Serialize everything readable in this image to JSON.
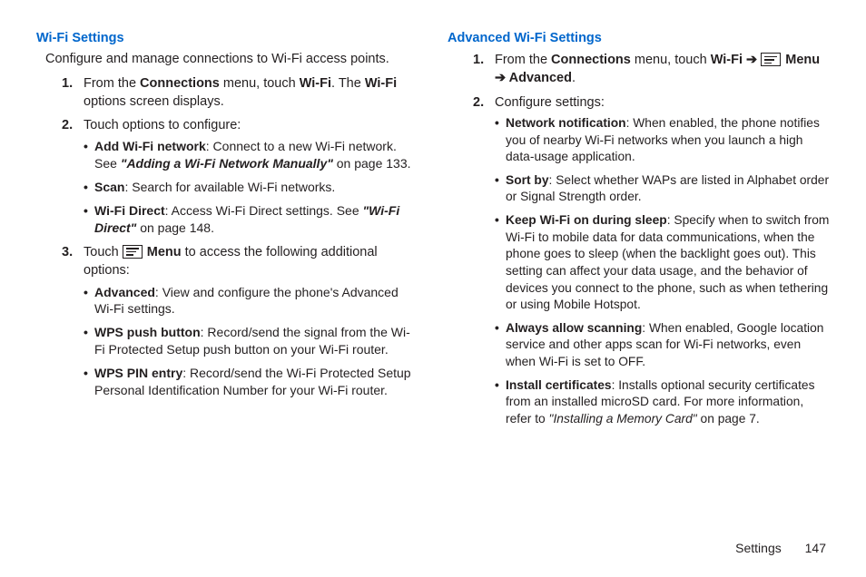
{
  "left": {
    "title": "Wi-Fi Settings",
    "intro": "Configure and manage connections to Wi-Fi access points.",
    "s1_num": "1.",
    "s1_a": "From the ",
    "s1_b": "Connections",
    "s1_c": " menu, touch ",
    "s1_d": "Wi-Fi",
    "s1_e": ". The ",
    "s1_f": "Wi-Fi",
    "s1_g": " options screen displays.",
    "s2_num": "2.",
    "s2_text": "Touch options to configure:",
    "s2_b1_a": "Add Wi-Fi network",
    "s2_b1_b": ": Connect to a new Wi-Fi network. See ",
    "s2_b1_c": "\"Adding a Wi-Fi Network Manually\"",
    "s2_b1_d": " on page 133.",
    "s2_b2_a": "Scan",
    "s2_b2_b": ": Search for available Wi-Fi networks.",
    "s2_b3_a": "Wi-Fi Direct",
    "s2_b3_b": ": Access Wi-Fi Direct settings. See ",
    "s2_b3_c": "\"Wi-Fi Direct\"",
    "s2_b3_d": " on page 148.",
    "s3_num": "3.",
    "s3_a": "Touch ",
    "s3_b": "Menu",
    "s3_c": " to access the following additional options:",
    "s3_b1_a": "Advanced",
    "s3_b1_b": ": View and configure the phone's Advanced Wi-Fi settings.",
    "s3_b2_a": "WPS push button",
    "s3_b2_b": ": Record/send the signal from the Wi-Fi Protected Setup push button on your Wi-Fi router.",
    "s3_b3_a": "WPS PIN entry",
    "s3_b3_b": ": Record/send the Wi-Fi Protected Setup Personal Identification Number for your Wi-Fi router."
  },
  "right": {
    "title": "Advanced Wi-Fi Settings",
    "s1_num": "1.",
    "s1_a": "From the ",
    "s1_b": "Connections",
    "s1_c": " menu, touch ",
    "s1_d": "Wi-Fi",
    "s1_e": " ➔ ",
    "s1_f": "Menu",
    "s1_g": " ➔ ",
    "s1_h": "Advanced",
    "s1_i": ".",
    "s2_num": "2.",
    "s2_text": "Configure settings:",
    "b1_a": "Network notification",
    "b1_b": ": When enabled, the phone notifies you of nearby Wi-Fi networks when you launch a high data-usage application.",
    "b2_a": "Sort by",
    "b2_b": ": Select whether WAPs are listed in Alphabet order or Signal Strength order.",
    "b3_a": "Keep Wi-Fi on during sleep",
    "b3_b": ": Specify when to switch from Wi-Fi to mobile data for data communications, when the phone goes to sleep (when the backlight goes out). This setting can affect your data usage, and the behavior of devices you connect to the phone, such as when tethering or using Mobile Hotspot.",
    "b4_a": "Always allow scanning",
    "b4_b": ": When enabled, Google location service and other apps scan for Wi-Fi networks, even when Wi-Fi is set to OFF.",
    "b5_a": "Install certificates",
    "b5_b": ": Installs optional security certificates from an installed microSD card. For more information, refer to ",
    "b5_c": "\"Installing a Memory Card\"",
    "b5_d": " on page 7."
  },
  "footer": {
    "section": "Settings",
    "page": "147"
  }
}
